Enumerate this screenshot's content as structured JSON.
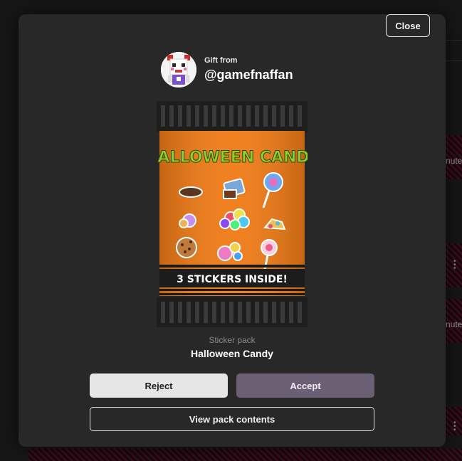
{
  "background_app": {
    "snippets": [
      "nute",
      "nute"
    ]
  },
  "modal": {
    "close_label": "Close",
    "gift": {
      "from_label": "Gift from",
      "username": "@gamefnaffan"
    },
    "pack": {
      "banner_title": "HALLOWEEN CANDY",
      "banner_footer": "3 STICKERS INSIDE!",
      "type_label": "Sticker pack",
      "name": "Halloween Candy"
    },
    "actions": {
      "reject_label": "Reject",
      "accept_label": "Accept",
      "view_contents_label": "View pack contents"
    }
  },
  "colors": {
    "modal_bg": "#282828",
    "accept_bg": "#6b5f74",
    "reject_bg": "#e6e6e6",
    "pack_orange": "#f07a14",
    "title_green": "#8ed12a"
  }
}
